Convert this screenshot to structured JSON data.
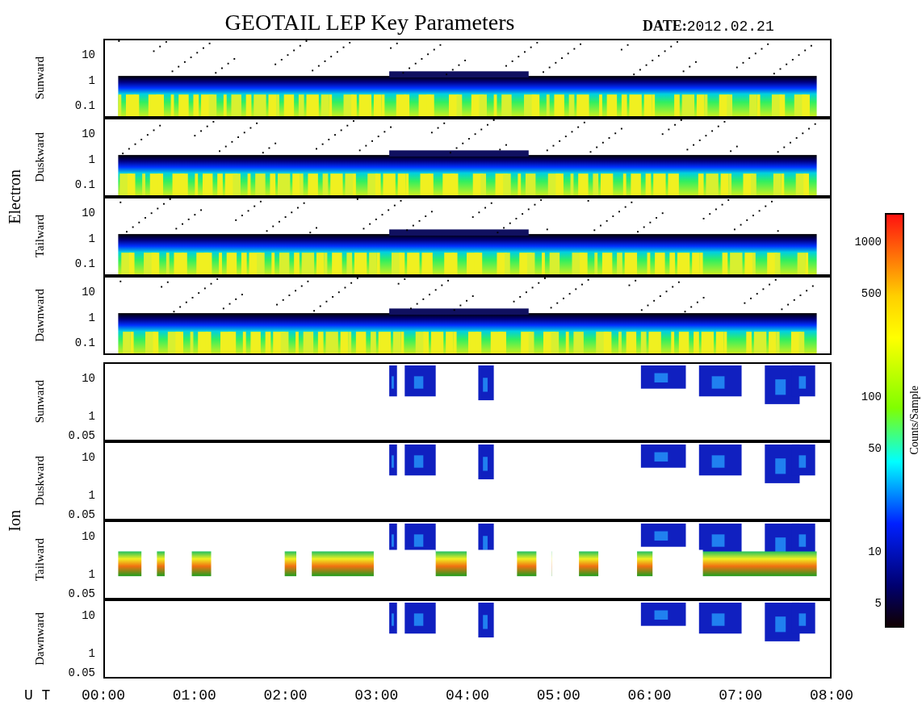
{
  "title": "GEOTAIL LEP Key Parameters",
  "date": {
    "label": "DATE:",
    "value": "2012.02.21"
  },
  "groups": [
    {
      "label": "Electron",
      "kind": "electron",
      "panels": [
        {
          "label": "Sunward",
          "kind": "band",
          "yticks": [
            "10",
            "1",
            "0.1"
          ]
        },
        {
          "label": "Duskward",
          "kind": "band",
          "yticks": [
            "10",
            "1",
            "0.1"
          ]
        },
        {
          "label": "Tailward",
          "kind": "band",
          "yticks": [
            "10",
            "1",
            "0.1"
          ]
        },
        {
          "label": "Dawnward",
          "kind": "band",
          "yticks": [
            "10",
            "1",
            "0.1"
          ]
        }
      ]
    },
    {
      "label": "Ion",
      "kind": "ion",
      "panels": [
        {
          "label": "Sunward",
          "kind": "patches",
          "yticks": [
            "10",
            "1",
            "0.05"
          ]
        },
        {
          "label": "Duskward",
          "kind": "patches",
          "yticks": [
            "10",
            "1",
            "0.05"
          ]
        },
        {
          "label": "Tailward",
          "kind": "patches_band",
          "yticks": [
            "10",
            "1",
            "0.05"
          ]
        },
        {
          "label": "Dawnward",
          "kind": "patches",
          "yticks": [
            "10",
            "1",
            "0.05"
          ]
        }
      ]
    }
  ],
  "time_axis": {
    "label": "U T",
    "ticks": [
      "00:00",
      "01:00",
      "02:00",
      "03:00",
      "04:00",
      "05:00",
      "06:00",
      "07:00",
      "08:00"
    ]
  },
  "colorbar": {
    "label": "Counts/Sample",
    "ticks": [
      "1000",
      "500",
      "100",
      "50",
      "10",
      "5"
    ]
  }
}
